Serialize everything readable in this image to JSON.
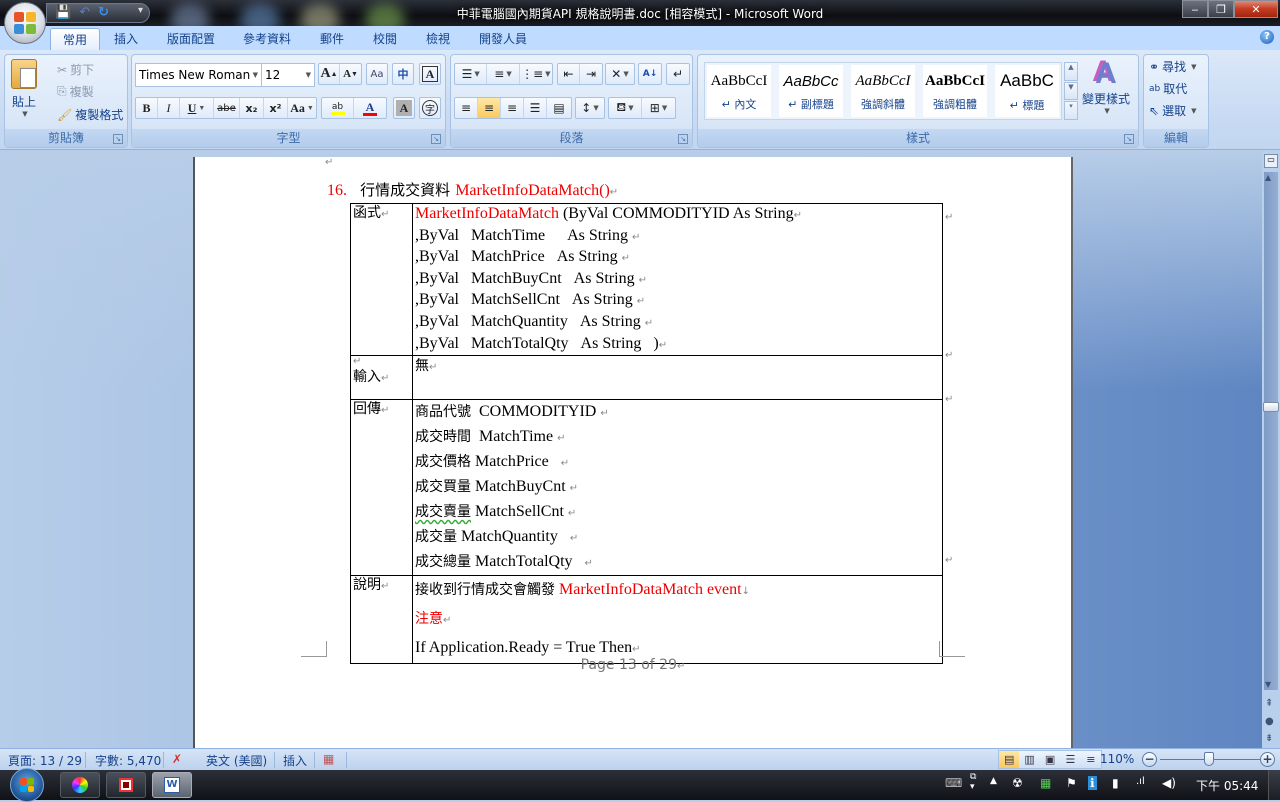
{
  "window": {
    "title": "中菲電腦國內期貨API 規格說明書.doc [相容模式] - Microsoft Word",
    "minimize_label": "‒",
    "maximize_label": "❐",
    "close_label": "✕"
  },
  "quick_access": {
    "save_icon": "💾",
    "undo_icon": "↶",
    "redo_icon": "↻",
    "more_icon": "▾"
  },
  "tabs": [
    {
      "label": "常用",
      "active": true
    },
    {
      "label": "插入"
    },
    {
      "label": "版面配置"
    },
    {
      "label": "參考資料"
    },
    {
      "label": "郵件"
    },
    {
      "label": "校閱"
    },
    {
      "label": "檢視"
    },
    {
      "label": "開發人員"
    }
  ],
  "help_label": "?",
  "ribbon": {
    "clipboard": {
      "group_label": "剪貼簿",
      "paste_label": "貼上",
      "cut_label": "剪下",
      "copy_label": "複製",
      "format_painter_label": "複製格式"
    },
    "font": {
      "group_label": "字型",
      "font_name": "Times New Roman",
      "font_size": "12",
      "grow_label": "A",
      "shrink_label": "A",
      "bold_label": "B",
      "italic_label": "I",
      "underline_label": "U",
      "strike_label": "abe",
      "subscript_label": "x₂",
      "superscript_label": "x²",
      "case_label": "Aa",
      "highlight_label": "ab",
      "font_color_label": "A",
      "char_shading_label": "A",
      "enclose_label": "字",
      "highlight_color": "#ffff00",
      "font_color": "#ff0000"
    },
    "paragraph": {
      "group_label": "段落",
      "active_alignment": "center"
    },
    "styles": {
      "group_label": "樣式",
      "items": [
        {
          "sample": "AaBbCcI",
          "name": "↵ 內文"
        },
        {
          "sample": "AaBbCc",
          "name": "↵ 副標題"
        },
        {
          "sample": "AaBbCcI",
          "name": "強調斜體"
        },
        {
          "sample": "AaBbCcI",
          "name": "強調粗體"
        },
        {
          "sample": "AaBbC",
          "name": "↵ 標題"
        }
      ],
      "change_styles_label": "變更樣式"
    },
    "editing": {
      "group_label": "編輯",
      "find_label": "尋找",
      "replace_label": "取代",
      "select_label": "選取"
    }
  },
  "document": {
    "heading_number": "16.",
    "heading_text": "行情成交資料",
    "heading_function": "MarketInfoDataMatch()",
    "para_mark": "↵",
    "rows": {
      "function": {
        "label": "函式",
        "first_line_red": "MarketInfoDataMatch",
        "first_line_rest": " (ByVal COMMODITYID As String",
        "params": [
          {
            "name": "MatchTime",
            "type": "As String"
          },
          {
            "name": "MatchPrice",
            "type": "As String"
          },
          {
            "name": "MatchBuyCnt",
            "type": "As String"
          },
          {
            "name": "MatchSellCnt",
            "type": "As String"
          },
          {
            "name": "MatchQuantity",
            "type": "As String"
          },
          {
            "name": "MatchTotalQty",
            "type": "As String   )"
          }
        ],
        "param_prefix": ",ByVal"
      },
      "input": {
        "label": "輸入",
        "value": "無"
      },
      "return": {
        "label": "回傳",
        "items": [
          {
            "zh": "商品代號",
            "en": "COMMODITYID"
          },
          {
            "zh": "成交時間",
            "en": "MatchTime"
          },
          {
            "zh": "成交價格",
            "en": "MatchPrice"
          },
          {
            "zh": "成交買量",
            "en": "MatchBuyCnt"
          },
          {
            "zh": "成交賣量",
            "en": "MatchSellCnt"
          },
          {
            "zh": "成交量",
            "en": "MatchQuantity"
          },
          {
            "zh": "成交總量",
            "en": "MatchTotalQty"
          }
        ]
      },
      "description": {
        "label": "說明",
        "line1_zh": "接收到行情成交會觸發",
        "line1_red": "MarketInfoDataMatch event",
        "note_label": "注意",
        "code_line": "If Application.Ready = True Then"
      }
    },
    "footer": "Page 13 of 29"
  },
  "statusbar": {
    "page": "頁面: 13 / 29",
    "words": "字數: 5,470",
    "language": "英文 (美國)",
    "mode": "插入",
    "zoom_level": "110%",
    "zoom_minus": "−",
    "zoom_plus": "+",
    "zoom_percent": 110
  },
  "taskbar": {
    "clock": "下午 05:44"
  }
}
